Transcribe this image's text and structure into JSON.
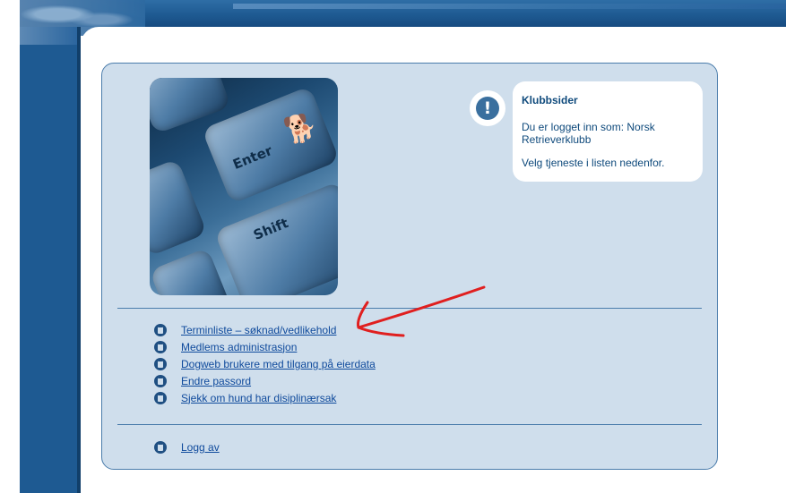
{
  "panel": {
    "callout": {
      "title": "Klubbsider",
      "line1": "Du er logget inn som: Norsk",
      "line2": "Retrieverklubb",
      "line3": "Velg tjeneste i listen nedenfor."
    },
    "photo": {
      "key_enter": "Enter",
      "key_shift": "Shift"
    },
    "menu": [
      {
        "label": "Terminliste – søknad/vedlikehold"
      },
      {
        "label": "Medlems administrasjon"
      },
      {
        "label": "Dogweb brukere med tilgang på eierdata"
      },
      {
        "label": "Endre passord"
      },
      {
        "label": "Sjekk om hund har disiplinærsak"
      }
    ],
    "logout": {
      "label": "Logg av"
    }
  },
  "annotation": {
    "color": "#e01f1f"
  },
  "icons": {
    "callout": "exclamation-icon",
    "menu_bullet": "document-icon"
  }
}
